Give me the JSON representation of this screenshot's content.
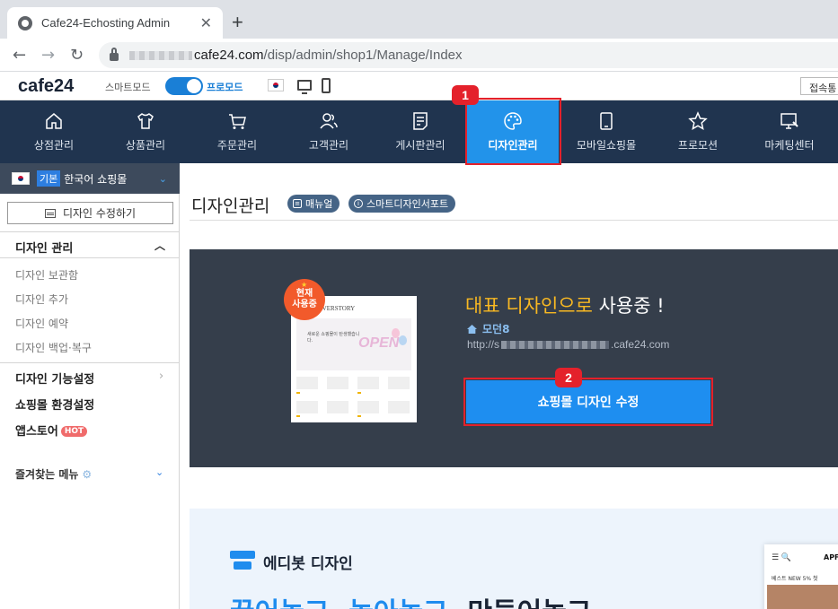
{
  "browser": {
    "tab_title": "Cafe24-Echosting Admin",
    "tab_close": "✕",
    "new_tab": "+",
    "back": "←",
    "forward": "→",
    "reload": "↻",
    "url_domain": "cafe24.com",
    "url_path": "/disp/admin/shop1/Manage/Index"
  },
  "topbar": {
    "logo": "cafe24",
    "smart_mode": "스마트모드",
    "pro_mode": "프로모드",
    "access_button": "접속통"
  },
  "nav": {
    "items": [
      {
        "label": "상점관리",
        "icon": "home-icon"
      },
      {
        "label": "상품관리",
        "icon": "shirt-icon"
      },
      {
        "label": "주문관리",
        "icon": "cart-icon"
      },
      {
        "label": "고객관리",
        "icon": "customers-icon"
      },
      {
        "label": "게시판관리",
        "icon": "board-icon"
      },
      {
        "label": "디자인관리",
        "icon": "palette-icon",
        "active": true
      },
      {
        "label": "모바일쇼핑몰",
        "icon": "mobile-icon"
      },
      {
        "label": "프로모션",
        "icon": "star-icon"
      },
      {
        "label": "마케팅센터",
        "icon": "marketing-icon"
      }
    ]
  },
  "annotations": {
    "badge1": "1",
    "badge2": "2"
  },
  "sidebar": {
    "shop_tag": "기본",
    "shop_name": "한국어 쇼핑몰",
    "shop_chevron": "⌄",
    "edit_button": "디자인 수정하기",
    "section_title": "디자인 관리",
    "section_toggle": "︿",
    "sub_items": [
      "디자인 보관함",
      "디자인 추가",
      "디자인 예약",
      "디자인 백업·복구"
    ],
    "menu_design_settings": "디자인 기능설정",
    "menu_arrow": "›",
    "menu_shop_env": "쇼핑몰 환경설정",
    "menu_appstore": "앱스토어",
    "hot_badge": "HOT",
    "favorites": "즐겨찾는 메뉴",
    "favorites_chevron": "⌄"
  },
  "content": {
    "page_title": "디자인관리",
    "manual_pill": "매뉴얼",
    "support_pill": "스마트디자인서포트",
    "now_badge_line1": "현재",
    "now_badge_line2": "사용중",
    "thumb_brand": "COVERSTORY",
    "thumb_hero_text": "새로운 쇼핑몰이 탄생했습니다.",
    "thumb_open": "OPEN",
    "rep_title_highlight": "대표 디자인으로",
    "rep_title_rest": " 사용중 !",
    "rep_design_name": "모던8",
    "rep_url_prefix": "http://s",
    "rep_url_suffix": ".cafe24.com",
    "design_edit_button": "쇼핑몰 디자인 수정"
  },
  "promo": {
    "editbot_label": "에디봇 디자인",
    "headline_blue": "끌어놓고, 놓아놓고, ",
    "headline_dark": "만들어놓고",
    "phone_menu": "☰  🔍",
    "phone_logo": "APF",
    "phone_tabs": "베스트   NEW 5%   첫"
  },
  "colors": {
    "nav_bg": "#20344f",
    "nav_active": "#2293ea",
    "accent_blue": "#1e8ef0",
    "highlight_red": "#e4212b",
    "dark_panel": "#353e4b",
    "rep_title_highlight": "#f8b822"
  }
}
